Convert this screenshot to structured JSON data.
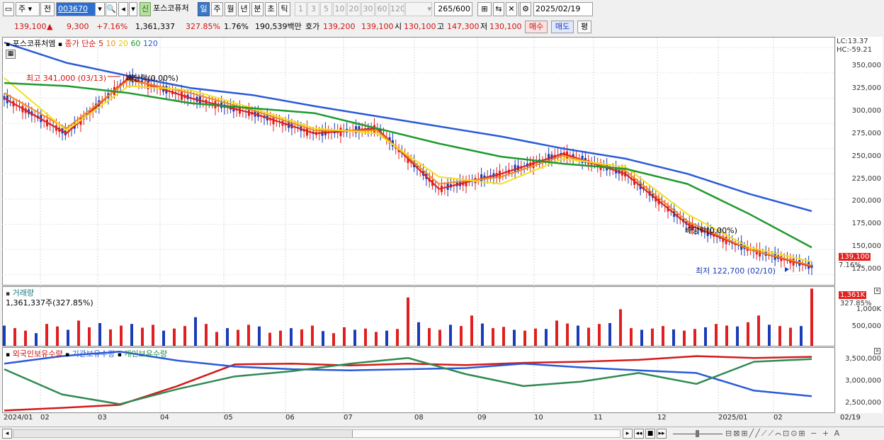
{
  "toolbar": {
    "type_label": "주",
    "jeon_label": "전",
    "code_value": "003670",
    "stock_name": "포스코퓨처",
    "shin_label": "신",
    "periods": [
      "일",
      "주",
      "월",
      "년",
      "분",
      "초",
      "틱"
    ],
    "active_period": "일",
    "numbers": [
      "1",
      "3",
      "5",
      "10",
      "20",
      "30",
      "60",
      "120"
    ],
    "count": "265",
    "count_total": "/600",
    "date": "2025/02/19"
  },
  "infobar": {
    "price": "139,100",
    "change_arrow": "▲",
    "change": "9,300",
    "change_pct": "+7.16%",
    "volume": "1,361,337",
    "volume_ratio": "327.85%",
    "turnover": "1.76%",
    "amount": "190,539백만",
    "quote_label": "호가",
    "ask": "139,200",
    "bid": "139,100",
    "open_label": "시",
    "open": "130,100",
    "high_label": "고",
    "high": "147,300",
    "low_label": "저",
    "low": "130,100",
    "buy_label": "매수",
    "sell_label": "매도",
    "pyeong_label": "평"
  },
  "price_panel": {
    "name": "포스코퓨처엠",
    "ma_label": "종가 단순",
    "ma_periods": [
      "5",
      "10",
      "20",
      "60",
      "120"
    ],
    "colors": {
      "ma5": "#e02020",
      "ma10": "#f08c1c",
      "ma20": "#f2e11c",
      "ma60": "#1e9a2e",
      "ma120": "#2a5ad8",
      "up": "#e02020",
      "down": "#1a3cb8"
    },
    "lc": "LC:13.37",
    "hc": "HC:-59.21",
    "high_note": "최고 341,000 (03/13)",
    "low_note": "최저 122,700 (02/10)",
    "div_note_1": "배당락(0.00%)",
    "div_note_2": "배당락(0.00%)",
    "current_tag": "139,100",
    "current_pct": "7.16%"
  },
  "volume_panel": {
    "title": "거래량",
    "subtitle": "1,361,337주(327.85%)",
    "tag": "1,361K",
    "tag_pct": "327.85%"
  },
  "holdings_panel": {
    "foreign": "외국인보유수량",
    "inst": "기관보유수량",
    "indiv": "개인보유수량"
  },
  "x_labels": [
    "2024/01",
    "02",
    "03",
    "04",
    "05",
    "06",
    "07",
    "08",
    "09",
    "10",
    "11",
    "12",
    "2025/01",
    "02",
    "02/19"
  ],
  "chart_data": [
    {
      "type": "line",
      "title": "",
      "ylim": [
        115000,
        360000
      ],
      "yticks": [
        "350,000",
        "325,000",
        "300,000",
        "275,000",
        "250,000",
        "225,000",
        "200,000",
        "175,000",
        "150,000",
        "125,000"
      ],
      "x": [
        "2024/01",
        "02",
        "03",
        "04",
        "05",
        "06",
        "07",
        "08",
        "09",
        "10",
        "11",
        "12",
        "2025/01",
        "02"
      ],
      "series": [
        {
          "name": "5",
          "values": [
            300000,
            265000,
            320000,
            300000,
            285000,
            265000,
            270000,
            210000,
            225000,
            245000,
            225000,
            175000,
            150000,
            133000
          ]
        },
        {
          "name": "10",
          "values": [
            305000,
            270000,
            318000,
            305000,
            288000,
            268000,
            268000,
            215000,
            222000,
            243000,
            228000,
            178000,
            150000,
            134000
          ]
        },
        {
          "name": "20",
          "values": [
            320000,
            268000,
            312000,
            308000,
            290000,
            270000,
            265000,
            222000,
            215000,
            240000,
            232000,
            185000,
            152000,
            138000
          ]
        },
        {
          "name": "60",
          "values": [
            315000,
            312000,
            305000,
            295000,
            290000,
            285000,
            270000,
            255000,
            242000,
            235000,
            230000,
            215000,
            185000,
            152000
          ]
        },
        {
          "name": "120",
          "values": [
            355000,
            335000,
            322000,
            310000,
            303000,
            292000,
            282000,
            272000,
            262000,
            250000,
            240000,
            225000,
            205000,
            188000
          ]
        }
      ]
    },
    {
      "type": "bar",
      "title": "거래량",
      "ylim": [
        0,
        1400000
      ],
      "yticks": [
        "1,000K",
        "500,000"
      ],
      "values": [
        480000,
        420000,
        360000,
        300000,
        520000,
        460000,
        380000,
        600000,
        440000,
        540000,
        390000,
        480000,
        520000,
        430000,
        500000,
        360000,
        410000,
        470000,
        680000,
        520000,
        330000,
        420000,
        380000,
        500000,
        460000,
        310000,
        360000,
        420000,
        390000,
        480000,
        350000,
        300000,
        440000,
        380000,
        410000,
        330000,
        360000,
        400000,
        1150000,
        560000,
        420000,
        380000,
        500000,
        470000,
        720000,
        530000,
        420000,
        450000,
        380000,
        360000,
        410000,
        400000,
        600000,
        530000,
        480000,
        430000,
        520000,
        540000,
        870000,
        420000,
        380000,
        410000,
        470000,
        390000,
        360000,
        400000,
        440000,
        520000,
        480000,
        460000,
        560000,
        720000,
        500000,
        470000,
        430000,
        470000,
        1361337
      ]
    },
    {
      "type": "line",
      "title": "보유수량",
      "ylim": [
        2000000,
        3700000
      ],
      "yticks": [
        "3,500,000",
        "3,000,000",
        "2,500,000"
      ],
      "series": [
        {
          "name": "외국인보유수량",
          "values": [
            2050000,
            2120000,
            2200000,
            2700000,
            3280000,
            3300000,
            3250000,
            3300000,
            3260000,
            3320000,
            3350000,
            3400000,
            3500000,
            3450000,
            3480000
          ]
        },
        {
          "name": "기관보유수량",
          "values": [
            3300000,
            3500000,
            3620000,
            3380000,
            3220000,
            3150000,
            3120000,
            3150000,
            3180000,
            3300000,
            3200000,
            3120000,
            3050000,
            2580000,
            2430000
          ]
        },
        {
          "name": "개인보유수량",
          "values": [
            3150000,
            2480000,
            2220000,
            2620000,
            2960000,
            3100000,
            3300000,
            3450000,
            3020000,
            2700000,
            2820000,
            3050000,
            2760000,
            3350000,
            3420000
          ]
        }
      ]
    }
  ]
}
